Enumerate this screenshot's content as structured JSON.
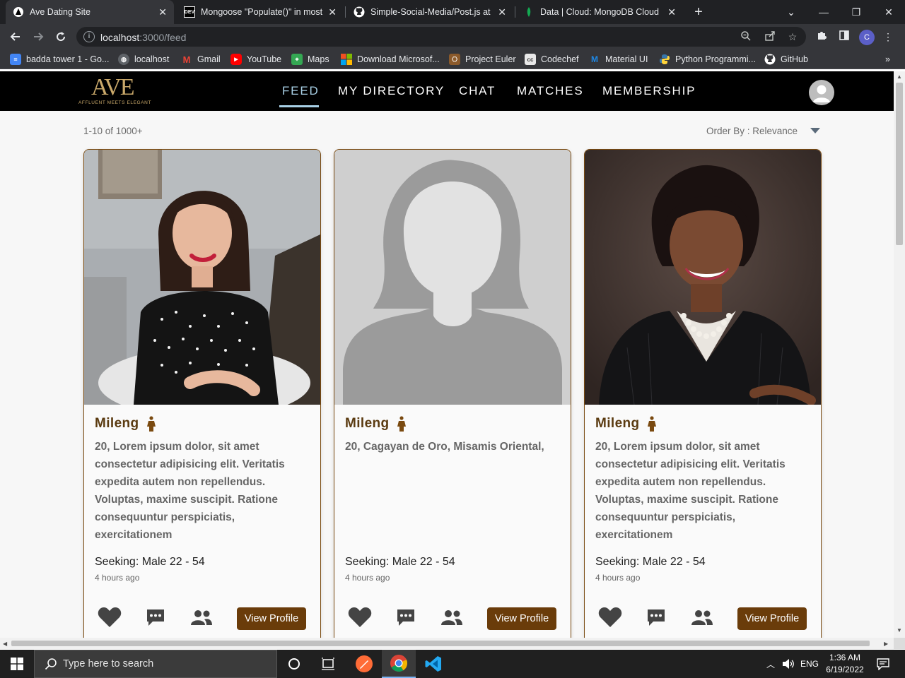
{
  "browser": {
    "tabs": [
      {
        "title": "Ave Dating Site",
        "favicon": "ave-icon",
        "active": true
      },
      {
        "title": "Mongoose \"Populate()\" in most s",
        "favicon": "dev-icon",
        "active": false
      },
      {
        "title": "Simple-Social-Media/Post.js at m",
        "favicon": "github-icon",
        "active": false
      },
      {
        "title": "Data | Cloud: MongoDB Cloud",
        "favicon": "mongodb-icon",
        "active": false
      }
    ],
    "address": {
      "host": "localhost",
      "path": ":3000/feed"
    },
    "profile_initial": "C",
    "bookmarks": [
      {
        "label": "badda tower 1 - Go...",
        "icon": "docs-icon"
      },
      {
        "label": "localhost",
        "icon": "globe-icon"
      },
      {
        "label": "Gmail",
        "icon": "gmail-icon"
      },
      {
        "label": "YouTube",
        "icon": "youtube-icon"
      },
      {
        "label": "Maps",
        "icon": "maps-icon"
      },
      {
        "label": "Download Microsof...",
        "icon": "microsoft-icon"
      },
      {
        "label": "Project Euler",
        "icon": "euler-icon"
      },
      {
        "label": "Codechef",
        "icon": "codechef-icon"
      },
      {
        "label": "Material UI",
        "icon": "mui-icon"
      },
      {
        "label": "Python Programmi...",
        "icon": "python-icon"
      },
      {
        "label": "GitHub",
        "icon": "github-icon"
      }
    ]
  },
  "site": {
    "logo": {
      "mark": "AVE",
      "tagline": "AFFLUENT MEETS ELEGANT"
    },
    "nav": [
      {
        "label": "FEED",
        "active": true
      },
      {
        "label": "MY DIRECTORY",
        "active": false
      },
      {
        "label": "CHAT",
        "active": false
      },
      {
        "label": "MATCHES",
        "active": false
      },
      {
        "label": "MEMBERSHIP",
        "active": false
      }
    ],
    "accent_color": "#6a3c0a",
    "nav_active_color": "#a8d0e6"
  },
  "feed": {
    "results_count": "1-10 of 1000+",
    "order_by": "Order By : Relevance",
    "view_profile_label": "View Profile",
    "cards": [
      {
        "name": "Mileng",
        "bio": "20, Lorem ipsum dolor, sit amet consectetur adipisicing elit. Veritatis expedita autem non repellendus. Voluptas, maxime suscipit. Ratione consequuntur perspiciatis, exercitationem",
        "seeking": "Seeking: Male 22 - 54",
        "time": "4 hours ago",
        "photo": "woman-polka-dot-dress-photo"
      },
      {
        "name": "Mileng",
        "bio": "20, Cagayan de Oro, Misamis Oriental,",
        "seeking": "Seeking: Male 22 - 54",
        "time": "4 hours ago",
        "photo": "placeholder-avatar"
      },
      {
        "name": "Mileng",
        "bio": "20, Lorem ipsum dolor, sit amet consectetur adipisicing elit. Veritatis expedita autem non repellendus. Voluptas, maxime suscipit. Ratione consequuntur perspiciatis, exercitationem",
        "seeking": "Seeking: Male 22 - 54",
        "time": "4 hours ago",
        "photo": "woman-business-suit-photo"
      }
    ]
  },
  "taskbar": {
    "search_placeholder": "Type here to search",
    "language": "ENG",
    "time": "1:36 AM",
    "date": "6/19/2022"
  }
}
